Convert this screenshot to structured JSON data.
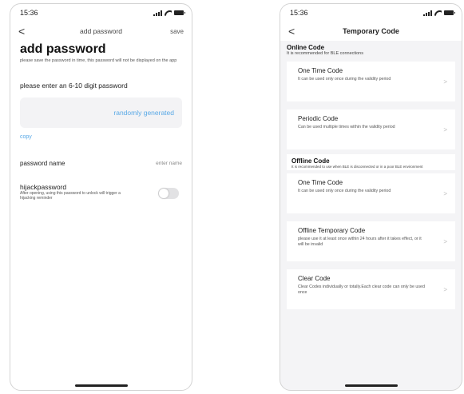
{
  "left": {
    "status_time": "15:36",
    "nav": {
      "back": "<",
      "title": "add password",
      "action": "save"
    },
    "title": "add password",
    "description": "please save the password in time, this password will not be displayed on the app",
    "enter_label": "please enter an 6-10 digit password",
    "random_label": "randomly generated",
    "copy_label": "copy",
    "name_label": "password name",
    "name_placeholder": "enter name",
    "hijack_title": "hijackpassword",
    "hijack_desc": "After opening, using this password to unlock will trigger a hijacking reminder",
    "hijack_enabled": false
  },
  "right": {
    "status_time": "15:36",
    "nav": {
      "back": "<",
      "title": "Temporary Code"
    },
    "online": {
      "title": "Online Code",
      "subtitle": "It is recommended for BLE connections",
      "items": [
        {
          "title": "One Time Code",
          "desc": "It can be used only once during the validity period"
        },
        {
          "title": "Periodic Code",
          "desc": "Can be used multiple times within the validity period"
        }
      ]
    },
    "offline": {
      "title": "Offline Code",
      "subtitle": "It is recommended to use when BLE is disconnected or in a poor BLE environment",
      "items": [
        {
          "title": "One Time Code",
          "desc": "It can be used only once during the validity period"
        },
        {
          "title": "Offline Temporary Code",
          "desc": "please use it at least once within 24 hours after it takes effect, or it will be invalid"
        },
        {
          "title": "Clear Code",
          "desc": "Clear Codes individually or totally.Each clear code can only be used once"
        }
      ]
    }
  },
  "colors": {
    "link": "#5aa9e6",
    "background": "#f4f4f6",
    "card": "#ffffff"
  },
  "icons": {
    "back": "chevron-left-icon",
    "item_arrow": "chevron-right-icon"
  }
}
